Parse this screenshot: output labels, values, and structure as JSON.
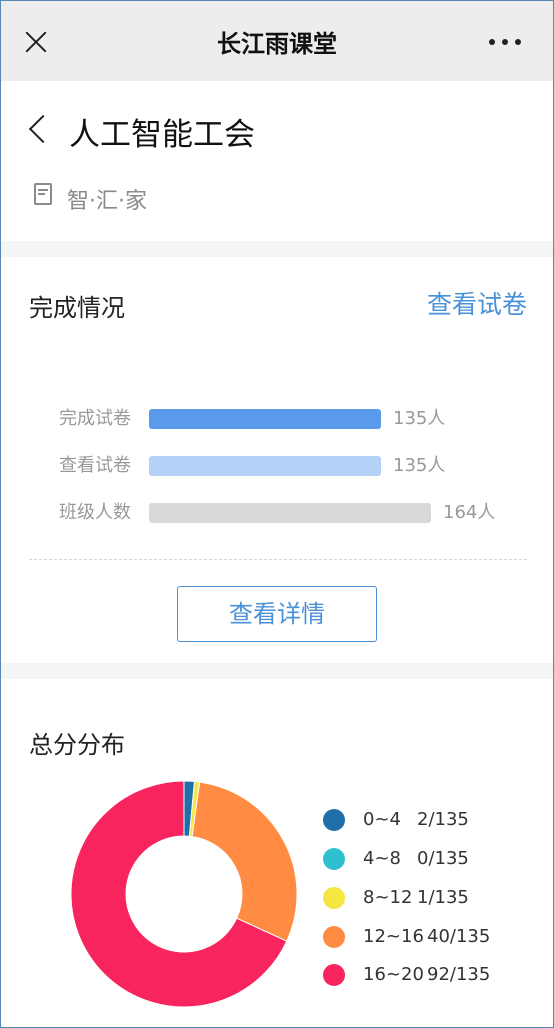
{
  "topbar": {
    "title": "长江雨课堂"
  },
  "header": {
    "title": "人工智能工会",
    "subtitle": "智·汇·家"
  },
  "completion": {
    "section_title": "完成情况",
    "view_paper_link": "查看试卷",
    "rows": [
      {
        "label": "完成试卷",
        "count": 135,
        "value_text": "135人",
        "color": "#5b9bec"
      },
      {
        "label": "查看试卷",
        "count": 135,
        "value_text": "135人",
        "color": "#b3d1f7"
      },
      {
        "label": "班级人数",
        "count": 164,
        "value_text": "164人",
        "color": "#d9d9d9"
      }
    ],
    "detail_button": "查看详情"
  },
  "distribution": {
    "section_title": "总分分布",
    "total": 135,
    "chart_data": {
      "type": "pie",
      "categories": [
        "0~4",
        "4~8",
        "8~12",
        "12~16",
        "16~20"
      ],
      "values": [
        2,
        0,
        1,
        40,
        92
      ],
      "labels": [
        "2/135",
        "0/135",
        "1/135",
        "40/135",
        "92/135"
      ],
      "colors": [
        "#1f6fa8",
        "#2fc0d0",
        "#f5e642",
        "#ff8c42",
        "#f7245e"
      ],
      "donut": true,
      "legend": "right"
    }
  }
}
